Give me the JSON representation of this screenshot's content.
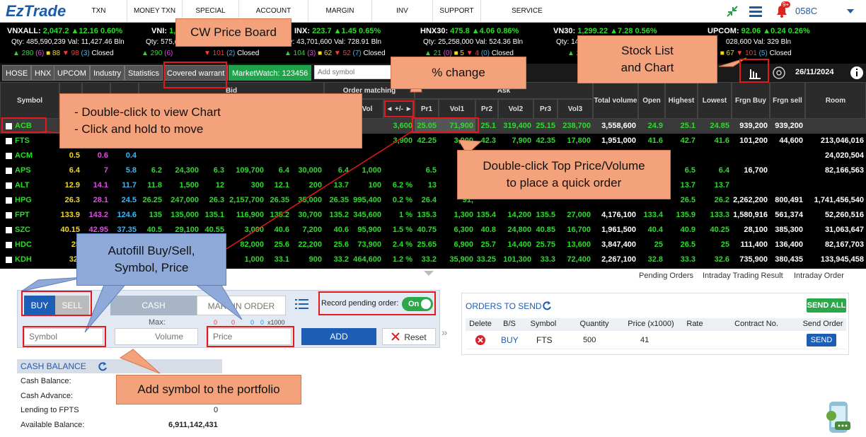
{
  "app": {
    "logo": "EzTrade",
    "user": "058C",
    "notif_badge": "9+",
    "date": "26/11/2024"
  },
  "nav": [
    "TXN HISTORY",
    "MONEY TXN",
    "SPECIAL TXN",
    "ACCOUNT MGMT",
    "MARGIN MGMT",
    "INV ADVISORY",
    "SUPPORT",
    "SERVICE MANAGEMENT"
  ],
  "indices": [
    {
      "name": "VNXALL:",
      "value": "2,047.2",
      "chg": "▲12.16",
      "pct": "0.60%",
      "qty": "Qty: 485,590,239 Val: 11,427.46 Bln",
      "up": "▲ 280",
      "ceil": "(6)",
      "ref": "■ 88",
      "down": "▼ 98",
      "floor": "(3)",
      "status": "Closed"
    },
    {
      "name": "VNI:",
      "value": "1,",
      "chg": "",
      "pct": "",
      "qty": "Qty: 575,(",
      "up": "▲ 290",
      "ceil": "(6)",
      "ref": "",
      "down": "▼ 101",
      "floor": "(2)",
      "status": "Closed"
    },
    {
      "name": "INX:",
      "value": "223.7",
      "chg": "▲1.45",
      "pct": "0.65%",
      "qty": "Qty: 43,701,600 Val: 728.91 Bln",
      "up": "▲ 104",
      "ceil": "(3)",
      "ref": "■ 62",
      "down": "▼ 52",
      "floor": "(7)",
      "status": "Closed"
    },
    {
      "name": "HNX30:",
      "value": "475.8",
      "chg": "▲4.06",
      "pct": "0.86%",
      "qty": "Qty: 25,258,000 Val: 524.36 Bln",
      "up": "▲ 21",
      "ceil": "(0)",
      "ref": "■ 5",
      "down": "▼ 4",
      "floor": "(0)",
      "status": "Closed"
    },
    {
      "name": "VN30:",
      "value": "1,299.22",
      "chg": "▲7.28",
      "pct": "0.56%",
      "qty": "Qty: 14",
      "up": "▲ 25",
      "ceil": "",
      "ref": "",
      "down": "",
      "floor": "",
      "status": ""
    },
    {
      "name": "UPCOM:",
      "value": "92.06",
      "chg": "▲0.24",
      "pct": "0.26%",
      "qty": "028,600 Val: 329 Bln",
      "up": "",
      "ceil": "0)",
      "ref": "■ 67",
      "down": "▼ 101",
      "floor": "(5)",
      "status": "Closed"
    }
  ],
  "tabs": [
    "HOSE",
    "HNX",
    "UPCOM",
    "Industry",
    "Statistics",
    "Covered warrant",
    "MarketWatch: 123456"
  ],
  "add_symbol_placeholder": "Add symbol",
  "table": {
    "headers": {
      "symbol": "Symbol",
      "bid": "Bid",
      "order_matching": "Order matching",
      "vol": "Vol",
      "pct_toggle": "◄ +/- ►",
      "ask": "Ask",
      "pr1": "Pr1",
      "vol1": "Vol1",
      "pr2": "Pr2",
      "vol2": "Vol2",
      "pr3": "Pr3",
      "vol3": "Vol3",
      "total_volume": "Total volume",
      "open": "Open",
      "highest": "Highest",
      "lowest": "Lowest",
      "frgn_buy": "Frgn Buy",
      "frgn_sell": "Frgn sell",
      "room": "Room"
    },
    "rows": [
      {
        "sym": "ACB",
        "c": [
          "",
          "",
          "",
          "",
          "",
          "",
          "",
          "",
          "",
          "",
          "",
          "3,600",
          "0.4 %",
          "25.05",
          "71,900",
          "25.1",
          "319,400",
          "25.15",
          "238,700",
          "3,558,600",
          "24.9",
          "25.1",
          "24.85",
          "939,200",
          "939,200",
          ""
        ]
      },
      {
        "sym": "FTS",
        "c": [
          "",
          "",
          "",
          "",
          "",
          "",
          "",
          "",
          "",
          "",
          "",
          "3,900",
          "1.3 %",
          "42.25",
          "3,900",
          "42.3",
          "7,900",
          "42.35",
          "17,800",
          "1,951,000",
          "41.6",
          "42.7",
          "41.6",
          "101,200",
          "44,600",
          "213,046,016"
        ]
      },
      {
        "sym": "ACM",
        "c": [
          "0.5",
          "0.6",
          "0.4",
          "",
          "",
          "",
          "",
          "",
          "",
          "",
          "",
          "",
          "",
          "",
          "",
          "",
          "",
          "",
          "",
          "",
          "",
          "",
          "",
          "",
          "",
          "24,020,504"
        ]
      },
      {
        "sym": "APS",
        "c": [
          "6.4",
          "7",
          "5.8",
          "6.2",
          "24,300",
          "6.3",
          "109,700",
          "6.4",
          "30,000",
          "6.4",
          "1,000",
          "",
          "",
          "6.5",
          "71,",
          "",
          "",
          "",
          "",
          "",
          "",
          "6.5",
          "6.4",
          "16,700",
          "",
          "82,166,563"
        ]
      },
      {
        "sym": "ALT",
        "c": [
          "12.9",
          "14.1",
          "11.7",
          "11.8",
          "1,500",
          "12",
          "300",
          "12.1",
          "200",
          "13.7",
          "100",
          "6.2 %",
          "",
          "13",
          "",
          "",
          "",
          "",
          "",
          "",
          "",
          "13.7",
          "13.7",
          "",
          "",
          ""
        ]
      },
      {
        "sym": "HPG",
        "c": [
          "26.3",
          "28.1",
          "24.5",
          "26.25",
          "247,000",
          "26.3",
          "2,157,700",
          "26.35",
          "35,000",
          "26.35",
          "995,400",
          "0.2 %",
          "",
          "26.4",
          "91,",
          "",
          "",
          "",
          "",
          "",
          "",
          "26.5",
          "26.2",
          "2,262,200",
          "800,491",
          "1,741,456,540"
        ]
      },
      {
        "sym": "FPT",
        "c": [
          "133.9",
          "143.2",
          "124.6",
          "135",
          "135,000",
          "135.1",
          "116,900",
          "135.2",
          "30,700",
          "135.2",
          "345,600",
          "1 %",
          "",
          "135.3",
          "1,300",
          "135.4",
          "14,200",
          "135.5",
          "27,000",
          "4,176,100",
          "133.4",
          "135.9",
          "133.3",
          "1,580,916",
          "561,374",
          "52,260,516"
        ]
      },
      {
        "sym": "SZC",
        "c": [
          "40.15",
          "42.95",
          "37.35",
          "40.5",
          "29,100",
          "40.55",
          "3,000",
          "40.6",
          "7,200",
          "40.6",
          "95,900",
          "1.5 %",
          "",
          "40.75",
          "6,300",
          "40.8",
          "24,800",
          "40.85",
          "16,700",
          "1,961,500",
          "40.4",
          "40.9",
          "40.25",
          "28,100",
          "385,300",
          "31,063,647"
        ]
      },
      {
        "sym": "HDC",
        "c": [
          "25",
          "",
          "",
          "",
          "",
          "",
          "82,000",
          "25.6",
          "22,200",
          "25.6",
          "73,900",
          "2.4 %",
          "",
          "25.65",
          "6,900",
          "25.7",
          "14,400",
          "25.75",
          "13,600",
          "3,847,400",
          "25",
          "26.5",
          "25",
          "111,400",
          "136,400",
          "82,167,703"
        ]
      },
      {
        "sym": "KDH",
        "c": [
          "32.",
          "",
          "",
          "",
          "",
          "",
          "1,000",
          "33.1",
          "900",
          "33.2",
          "464,600",
          "1.2 %",
          "",
          "33.2",
          "35,900",
          "33.25",
          "101,300",
          "33.3",
          "72,400",
          "2,267,100",
          "32.8",
          "33.3",
          "32.6",
          "735,900",
          "380,435",
          "133,945,458"
        ]
      }
    ]
  },
  "right_links": [
    "Pending Orders",
    "Intraday Trading Result",
    "Intraday Order"
  ],
  "order_form": {
    "buy": "BUY",
    "sell": "SELL",
    "cash": "CASH",
    "margin": "MARGIN ORDER",
    "record_pending": "Record pending order:",
    "toggle": "On",
    "max": "Max:",
    "zeros": [
      "0",
      "0",
      "0",
      "0"
    ],
    "x1000": "x1000",
    "symbol_ph": "Symbol",
    "volume_ph": "Volume",
    "price_ph": "Price",
    "add": "ADD",
    "reset": "Reset"
  },
  "orders_to_send": {
    "title": "ORDERS TO SEND",
    "send_all": "SEND ALL",
    "headers": [
      "Delete",
      "B/S",
      "Symbol",
      "Quantity",
      "Price (x1000)",
      "Rate",
      "Contract No.",
      "Send Order"
    ],
    "row": {
      "bs": "BUY",
      "symbol": "FTS",
      "qty": "500",
      "price": "41",
      "send": "SEND"
    }
  },
  "cash_balance": {
    "title": "CASH BALANCE",
    "rows": [
      {
        "label": "Cash Balance:",
        "value": ""
      },
      {
        "label": "Cash Advance:",
        "value": ""
      },
      {
        "label": "Lending to FPTS",
        "value": "0"
      },
      {
        "label": "Available Balance:",
        "value": "6,911,142,431"
      }
    ]
  },
  "callouts": {
    "cw_price_board": "CW Price Board",
    "pct_change": "% change",
    "stock_list_chart": "Stock List\nand Chart",
    "double_click_chart": "-  Double-click to view Chart\n- Click and hold to move",
    "double_click_order": "Double-click Top Price/Volume\nto place a quick order",
    "autofill": "Autofill Buy/Sell,\nSymbol, Price",
    "add_portfolio": "Add symbol to the portfolio"
  },
  "colors": {
    "accent": "#1a5ca8",
    "up": "#2ddc2d",
    "ref": "#f2d820",
    "down": "#ff3a3a",
    "ceil": "#e24ce2",
    "floor": "#39b8ff",
    "callout": "#f4a27b",
    "callout_blue": "#8fa9d8"
  }
}
